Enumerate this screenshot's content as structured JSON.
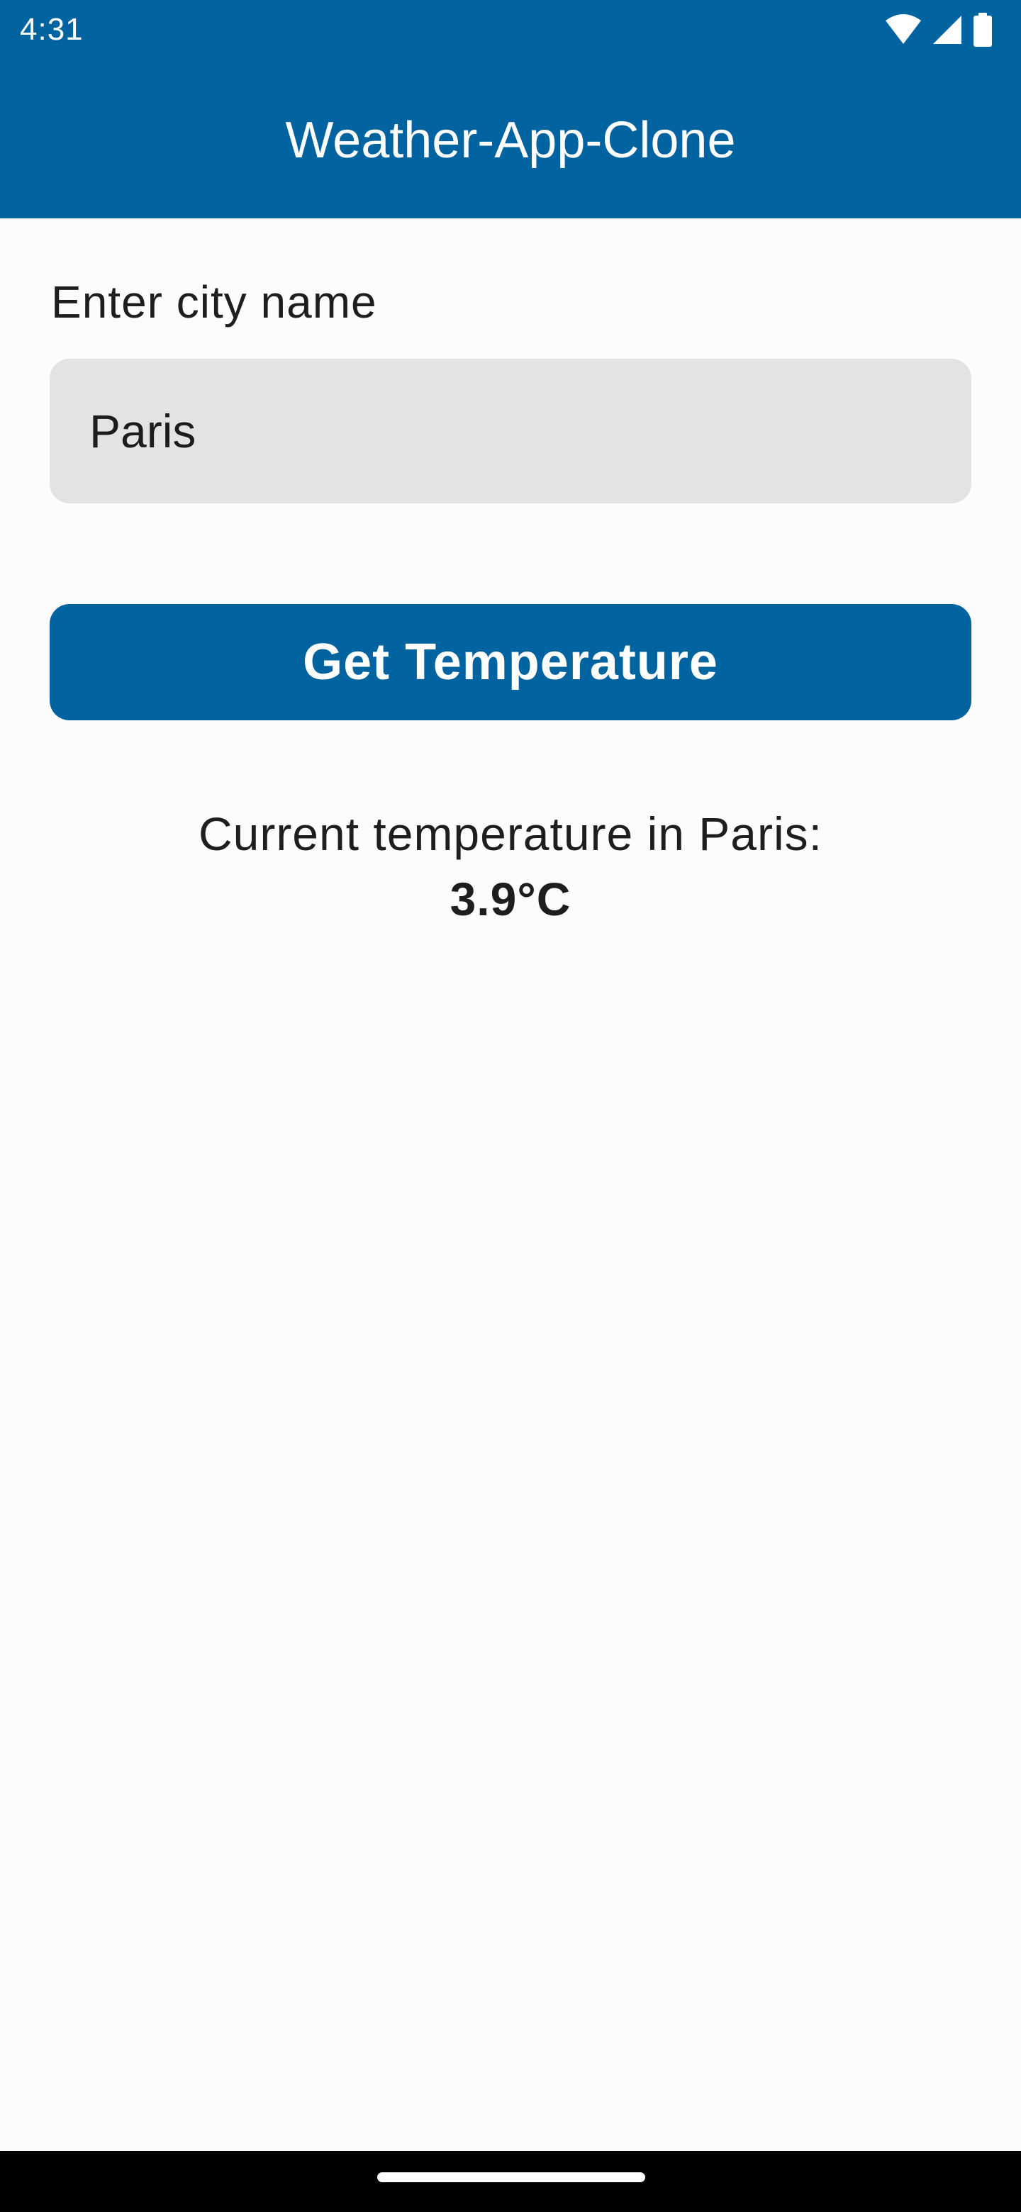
{
  "status_bar": {
    "time": "4:31",
    "icons": [
      "wifi-icon",
      "signal-icon",
      "battery-icon"
    ]
  },
  "app_bar": {
    "title": "Weather-App-Clone"
  },
  "form": {
    "city_label": "Enter city name",
    "city_value": "Paris",
    "button_label": "Get Temperature"
  },
  "result": {
    "line": "Current temperature in Paris:",
    "value": "3.9°C"
  },
  "colors": {
    "primary": "#01639f",
    "input_bg": "#e3e3e3",
    "background": "#fcfcfc"
  }
}
